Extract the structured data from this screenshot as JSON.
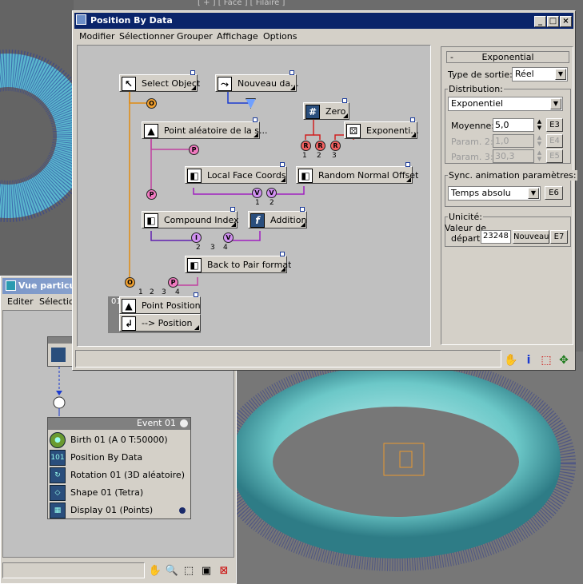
{
  "viewport_top": {
    "label": "[ + ] [ Face ] [ Filaire ]"
  },
  "pv": {
    "title": "Vue particule",
    "menu": [
      "Editer",
      "Sélection"
    ],
    "event": {
      "name": "Event 01",
      "items": [
        {
          "label": "Birth 01 (A 0 T:50000)",
          "icon": "birth-icon"
        },
        {
          "label": "Position By Data",
          "icon": "data-icon"
        },
        {
          "label": "Rotation 01 (3D aléatoire)",
          "icon": "rotation-icon"
        },
        {
          "label": "Shape 01 (Tetra)",
          "icon": "shape-icon"
        },
        {
          "label": "Display 01 (Points)",
          "icon": "display-icon"
        }
      ]
    },
    "toolbar": [
      "hand-icon",
      "zoom-icon",
      "zoom-region-icon",
      "fit-icon",
      "no-zoom-icon"
    ]
  },
  "dialog": {
    "title": "Position By Data",
    "menu": [
      "Modifier",
      "Sélectionner",
      "Grouper",
      "Affichage",
      "Options"
    ],
    "operators": {
      "select_object": "Select Object",
      "nouveau": "Nouveau da...",
      "zero": "Zero",
      "exponenti": "Exponenti...",
      "point_aleatoire": "Point aléatoire de la s...",
      "local_face": "Local Face Coords",
      "random_normal": "Random Normal Offset",
      "compound": "Compound Index",
      "addition": "Addition",
      "back_to_pair": "Back to Pair format",
      "point_position": "Point Position",
      "to_position": "--> Position",
      "output_id": "01"
    },
    "port_labels": {
      "o": "O",
      "p": "P",
      "r": "R",
      "v": "V",
      "i": "I"
    },
    "port_numbers": {
      "n1": "1",
      "n2": "2",
      "n3": "3",
      "n4": "4"
    },
    "panel": {
      "rollout": "Exponential",
      "rollout_toggle": "-",
      "output_type_label": "Type de sortie:",
      "output_type": "Réel",
      "distribution_label": "Distribution:",
      "distribution": "Exponentiel",
      "moyenne_label": "Moyenne:",
      "moyenne": "5,0",
      "e3": "E3",
      "param2_label": "Param. 2:",
      "param2": "1,0",
      "e4": "E4",
      "param3_label": "Param. 3:",
      "param3": "30,3",
      "e5": "E5",
      "sync_label": "Sync. animation paramètres:",
      "sync": "Temps absolu",
      "e6": "E6",
      "unicite_label": "Unicité:",
      "valeur_label_1": "Valeur de",
      "valeur_label_2": "départ:",
      "seed": "23248",
      "nouveau_btn": "Nouveau",
      "e7": "E7"
    },
    "toolbar": [
      "hand-icon",
      "info-icon",
      "region-select-icon",
      "move-icon"
    ]
  },
  "colors": {
    "title_active": "#0a246a",
    "title_inactive": "#7a96c8",
    "wire_pink": "#c040a0",
    "wire_orange": "#e08a10",
    "wire_blue": "#1a3ad0",
    "wire_red": "#d02020"
  }
}
